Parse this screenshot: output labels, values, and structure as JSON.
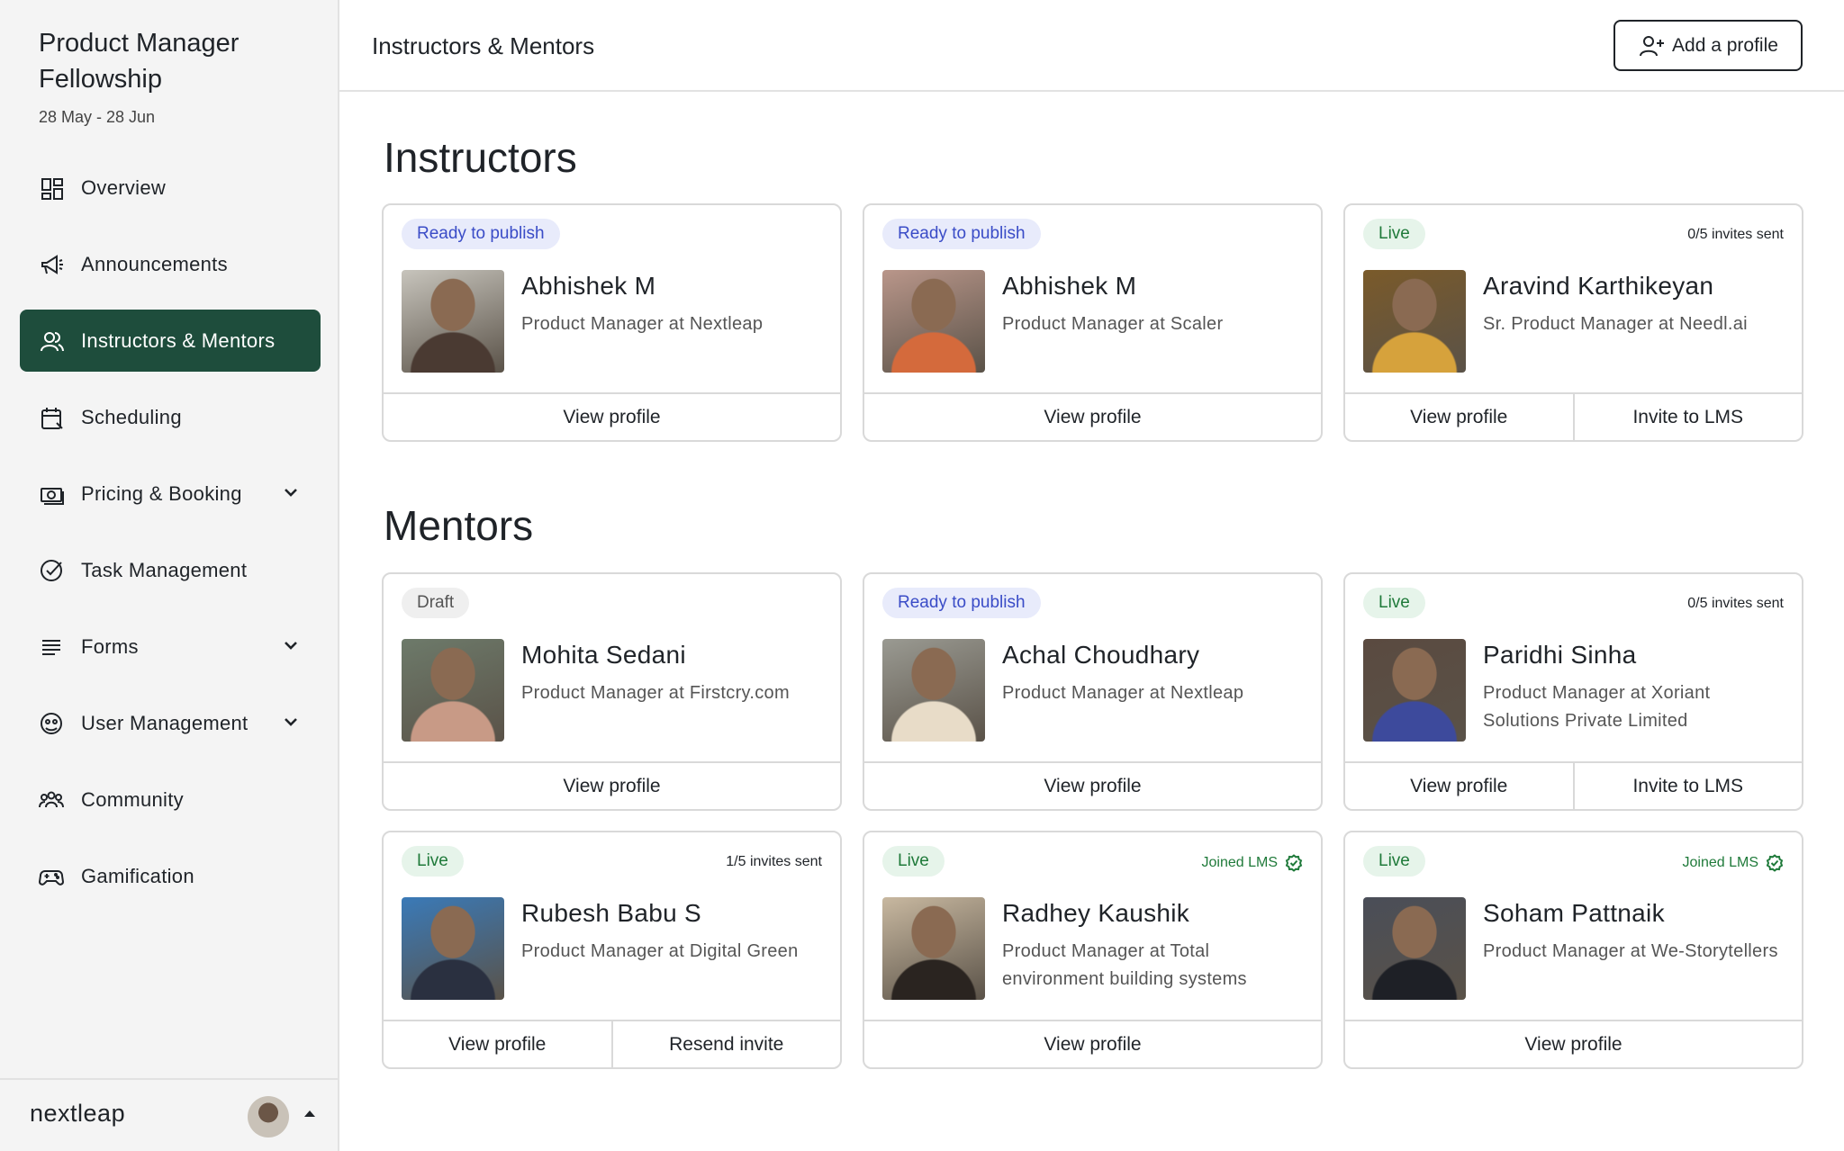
{
  "sidebar": {
    "brand_title": "Product Manager Fellowship",
    "brand_dates": "28 May - 28 Jun",
    "items": [
      {
        "label": "Overview",
        "icon": "dashboard-icon",
        "active": false,
        "chevron": false
      },
      {
        "label": "Announcements",
        "icon": "megaphone-icon",
        "active": false,
        "chevron": false
      },
      {
        "label": "Instructors & Mentors",
        "icon": "users-icon",
        "active": true,
        "chevron": false
      },
      {
        "label": "Scheduling",
        "icon": "calendar-icon",
        "active": false,
        "chevron": false
      },
      {
        "label": "Pricing & Booking",
        "icon": "money-icon",
        "active": false,
        "chevron": true
      },
      {
        "label": "Task Management",
        "icon": "check-circle-icon",
        "active": false,
        "chevron": false
      },
      {
        "label": "Forms",
        "icon": "list-icon",
        "active": false,
        "chevron": true
      },
      {
        "label": "User Management",
        "icon": "user-circle-icon",
        "active": false,
        "chevron": true
      },
      {
        "label": "Community",
        "icon": "community-icon",
        "active": false,
        "chevron": false
      },
      {
        "label": "Gamification",
        "icon": "gamepad-icon",
        "active": false,
        "chevron": false
      }
    ],
    "footer_logo": "nextleap"
  },
  "header": {
    "title": "Instructors & Mentors",
    "add_button_label": "Add a profile"
  },
  "sections": {
    "instructors_title": "Instructors",
    "mentors_title": "Mentors"
  },
  "instructors": [
    {
      "status": "Ready to publish",
      "status_type": "ready",
      "meta": "",
      "name": "Abhishek M",
      "role": "Product Manager at Nextleap",
      "actions": [
        "View profile"
      ],
      "photo_colors": [
        "#c7c4bc",
        "#4a3a32"
      ]
    },
    {
      "status": "Ready to publish",
      "status_type": "ready",
      "meta": "",
      "name": "Abhishek M",
      "role": "Product Manager at Scaler",
      "actions": [
        "View profile"
      ],
      "photo_colors": [
        "#b9968a",
        "#d46a3c"
      ]
    },
    {
      "status": "Live",
      "status_type": "live",
      "meta": "0/5 invites sent",
      "name": "Aravind Karthikeyan",
      "role": "Sr. Product Manager at Needl.ai",
      "actions": [
        "View profile",
        "Invite to LMS"
      ],
      "photo_colors": [
        "#7a5a2a",
        "#d6a23c"
      ]
    }
  ],
  "mentors": [
    {
      "status": "Draft",
      "status_type": "draft",
      "meta": "",
      "name": "Mohita Sedani",
      "role": "Product Manager at Firstcry.com",
      "actions": [
        "View profile"
      ],
      "photo_colors": [
        "#6d7a6a",
        "#c89a86"
      ]
    },
    {
      "status": "Ready to publish",
      "status_type": "ready",
      "meta": "",
      "name": "Achal Choudhary",
      "role": "Product Manager at Nextleap",
      "actions": [
        "View profile"
      ],
      "photo_colors": [
        "#9a9a92",
        "#e8dcc8"
      ]
    },
    {
      "status": "Live",
      "status_type": "live",
      "meta": "0/5 invites sent",
      "name": "Paridhi Sinha",
      "role": "Product Manager at Xoriant Solutions Private Limited",
      "actions": [
        "View profile",
        "Invite to LMS"
      ],
      "photo_colors": [
        "#5a4a40",
        "#3d4a9c"
      ]
    },
    {
      "status": "Live",
      "status_type": "live",
      "meta": "1/5 invites sent",
      "name": "Rubesh Babu S",
      "role": "Product Manager at Digital Green",
      "actions": [
        "View profile",
        "Resend invite"
      ],
      "photo_colors": [
        "#3a7ab8",
        "#2a3040"
      ]
    },
    {
      "status": "Live",
      "status_type": "live",
      "meta": "Joined LMS",
      "meta_type": "joined",
      "name": "Radhey Kaushik",
      "role": "Product Manager at Total environment building systems",
      "actions": [
        "View profile"
      ],
      "photo_colors": [
        "#c8b8a0",
        "#2a2420"
      ]
    },
    {
      "status": "Live",
      "status_type": "live",
      "meta": "Joined LMS",
      "meta_type": "joined",
      "name": "Soham Pattnaik",
      "role": "Product Manager at We-Storytellers",
      "actions": [
        "View profile"
      ],
      "photo_colors": [
        "#4a4e58",
        "#1e2026"
      ]
    }
  ]
}
